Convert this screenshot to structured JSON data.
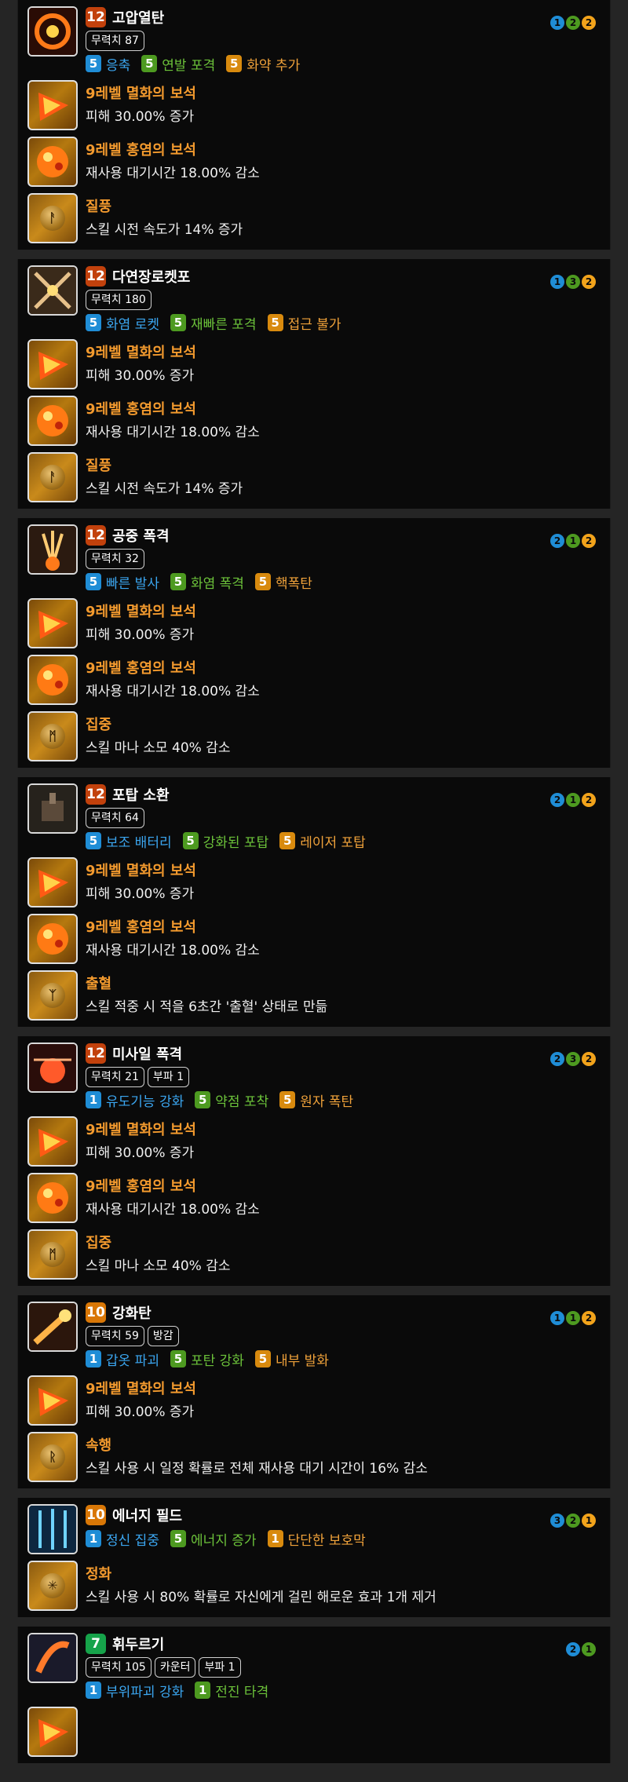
{
  "colors": {
    "blue": "#1f8dd6",
    "green": "#4d9a20",
    "orange": "#d88a0e",
    "gem_title": "#f39a2e"
  },
  "skills": [
    {
      "level": "12",
      "name": "고압열탄",
      "tags": [
        "무력치 87"
      ],
      "dots": [
        {
          "n": "1",
          "c": "blue"
        },
        {
          "n": "2",
          "c": "green"
        },
        {
          "n": "2",
          "c": "orange"
        }
      ],
      "tripods": [
        {
          "n": "5",
          "name": "응축",
          "c": "blue"
        },
        {
          "n": "5",
          "name": "연발 포격",
          "c": "green"
        },
        {
          "n": "5",
          "name": "화약 추가",
          "c": "orange"
        }
      ],
      "rows": [
        {
          "kind": "gem-fire",
          "title": "9레벨 멸화의 보석",
          "desc": "피해 30.00% 증가"
        },
        {
          "kind": "gem-red",
          "title": "9레벨 홍염의 보석",
          "desc": "재사용 대기시간 18.00% 감소"
        },
        {
          "kind": "rune",
          "glyph": "ᚨ",
          "title": "질풍",
          "desc": "스킬 시전 속도가 14% 증가"
        }
      ]
    },
    {
      "level": "12",
      "name": "다연장로켓포",
      "tags": [
        "무력치 180"
      ],
      "dots": [
        {
          "n": "1",
          "c": "blue"
        },
        {
          "n": "3",
          "c": "green"
        },
        {
          "n": "2",
          "c": "orange"
        }
      ],
      "tripods": [
        {
          "n": "5",
          "name": "화염 로켓",
          "c": "blue"
        },
        {
          "n": "5",
          "name": "재빠른 포격",
          "c": "green"
        },
        {
          "n": "5",
          "name": "접근 불가",
          "c": "orange"
        }
      ],
      "rows": [
        {
          "kind": "gem-fire",
          "title": "9레벨 멸화의 보석",
          "desc": "피해 30.00% 증가"
        },
        {
          "kind": "gem-red",
          "title": "9레벨 홍염의 보석",
          "desc": "재사용 대기시간 18.00% 감소"
        },
        {
          "kind": "rune",
          "glyph": "ᚨ",
          "title": "질풍",
          "desc": "스킬 시전 속도가 14% 증가"
        }
      ]
    },
    {
      "level": "12",
      "name": "공중 폭격",
      "tags": [
        "무력치 32"
      ],
      "dots": [
        {
          "n": "2",
          "c": "blue"
        },
        {
          "n": "1",
          "c": "green"
        },
        {
          "n": "2",
          "c": "orange"
        }
      ],
      "tripods": [
        {
          "n": "5",
          "name": "빠른 발사",
          "c": "blue"
        },
        {
          "n": "5",
          "name": "화염 폭격",
          "c": "green"
        },
        {
          "n": "5",
          "name": "핵폭탄",
          "c": "orange"
        }
      ],
      "rows": [
        {
          "kind": "gem-fire",
          "title": "9레벨 멸화의 보석",
          "desc": "피해 30.00% 증가"
        },
        {
          "kind": "gem-red",
          "title": "9레벨 홍염의 보석",
          "desc": "재사용 대기시간 18.00% 감소"
        },
        {
          "kind": "rune",
          "glyph": "ᛗ",
          "title": "집중",
          "desc": "스킬 마나 소모 40% 감소"
        }
      ]
    },
    {
      "level": "12",
      "name": "포탑 소환",
      "tags": [
        "무력치 64"
      ],
      "dots": [
        {
          "n": "2",
          "c": "blue"
        },
        {
          "n": "1",
          "c": "green"
        },
        {
          "n": "2",
          "c": "orange"
        }
      ],
      "tripods": [
        {
          "n": "5",
          "name": "보조 배터리",
          "c": "blue"
        },
        {
          "n": "5",
          "name": "강화된 포탑",
          "c": "green"
        },
        {
          "n": "5",
          "name": "레이저 포탑",
          "c": "orange"
        }
      ],
      "rows": [
        {
          "kind": "gem-fire",
          "title": "9레벨 멸화의 보석",
          "desc": "피해 30.00% 증가"
        },
        {
          "kind": "gem-red",
          "title": "9레벨 홍염의 보석",
          "desc": "재사용 대기시간 18.00% 감소"
        },
        {
          "kind": "rune",
          "glyph": "ᛉ",
          "title": "출혈",
          "desc": "스킬 적중 시 적을 6초간 '출혈' 상태로 만듦"
        }
      ]
    },
    {
      "level": "12",
      "name": "미사일 폭격",
      "tags": [
        "무력치 21",
        "부파 1"
      ],
      "dots": [
        {
          "n": "2",
          "c": "blue"
        },
        {
          "n": "3",
          "c": "green"
        },
        {
          "n": "2",
          "c": "orange"
        }
      ],
      "tripods": [
        {
          "n": "1",
          "name": "유도기능 강화",
          "c": "blue"
        },
        {
          "n": "5",
          "name": "약점 포착",
          "c": "green"
        },
        {
          "n": "5",
          "name": "원자 폭탄",
          "c": "orange"
        }
      ],
      "rows": [
        {
          "kind": "gem-fire",
          "title": "9레벨 멸화의 보석",
          "desc": "피해 30.00% 증가"
        },
        {
          "kind": "gem-red",
          "title": "9레벨 홍염의 보석",
          "desc": "재사용 대기시간 18.00% 감소"
        },
        {
          "kind": "rune",
          "glyph": "ᛗ",
          "title": "집중",
          "desc": "스킬 마나 소모 40% 감소"
        }
      ]
    },
    {
      "level": "10",
      "name": "강화탄",
      "tags": [
        "무력치 59",
        "방감"
      ],
      "dots": [
        {
          "n": "1",
          "c": "blue"
        },
        {
          "n": "1",
          "c": "green"
        },
        {
          "n": "2",
          "c": "orange"
        }
      ],
      "tripods": [
        {
          "n": "1",
          "name": "갑옷 파괴",
          "c": "blue"
        },
        {
          "n": "5",
          "name": "포탄 강화",
          "c": "green"
        },
        {
          "n": "5",
          "name": "내부 발화",
          "c": "orange"
        }
      ],
      "rows": [
        {
          "kind": "gem-fire",
          "title": "9레벨 멸화의 보석",
          "desc": "피해 30.00% 증가"
        },
        {
          "kind": "rune",
          "glyph": "ᚱ",
          "title": "속행",
          "desc": "스킬 사용 시 일정 확률로 전체 재사용 대기 시간이 16% 감소"
        }
      ]
    },
    {
      "level": "10",
      "name": "에너지 필드",
      "tags": [],
      "dots": [
        {
          "n": "3",
          "c": "blue"
        },
        {
          "n": "2",
          "c": "green"
        },
        {
          "n": "1",
          "c": "orange"
        }
      ],
      "tripods": [
        {
          "n": "1",
          "name": "정신 집중",
          "c": "blue"
        },
        {
          "n": "5",
          "name": "에너지 증가",
          "c": "green"
        },
        {
          "n": "1",
          "name": "단단한 보호막",
          "c": "orange"
        }
      ],
      "rows": [
        {
          "kind": "rune",
          "glyph": "✳",
          "title": "정화",
          "desc": "스킬 사용 시 80% 확률로 자신에게 걸린 해로운 효과 1개 제거"
        }
      ]
    },
    {
      "level": "7",
      "name": "휘두르기",
      "tags": [
        "무력치 105",
        "카운터",
        "부파 1"
      ],
      "dots": [
        {
          "n": "2",
          "c": "blue"
        },
        {
          "n": "1",
          "c": "green"
        }
      ],
      "tripods": [
        {
          "n": "1",
          "name": "부위파괴 강화",
          "c": "blue"
        },
        {
          "n": "1",
          "name": "전진 타격",
          "c": "green"
        }
      ],
      "rows": [
        {
          "kind": "gem-fire",
          "title": "",
          "desc": ""
        }
      ]
    }
  ]
}
